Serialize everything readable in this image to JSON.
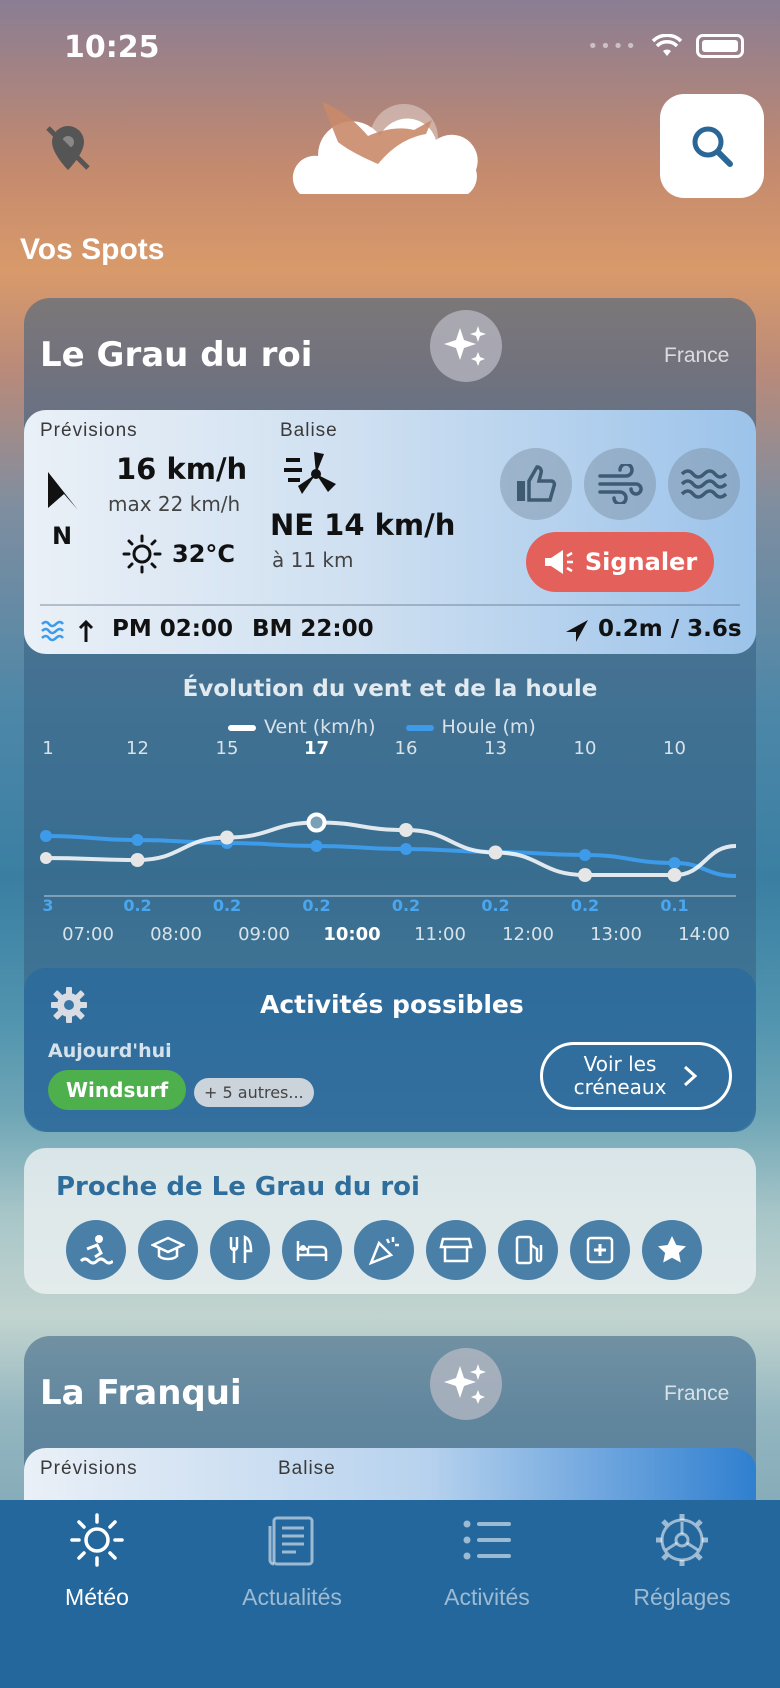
{
  "status": {
    "time": "10:25"
  },
  "header": {
    "section_title": "Vos Spots"
  },
  "spots": [
    {
      "name": "Le Grau du roi",
      "country": "France",
      "forecast_label": "Prévisions",
      "buoy_label": "Balise",
      "wind_dir": "N",
      "wind_speed": "16 km/h",
      "wind_max": "max 22 km/h",
      "temperature": "32°C",
      "buoy_wind": "NE 14 km/h",
      "buoy_distance": "à 11 km",
      "report_label": "Signaler",
      "high_tide": "PM 02:00",
      "low_tide": "BM 22:00",
      "swell": "0.2m / 3.6s"
    },
    {
      "name": "La Franqui",
      "country": "France",
      "forecast_label": "Prévisions",
      "buoy_label": "Balise"
    }
  ],
  "chart_data": {
    "type": "line",
    "title": "Évolution du vent et de la houle",
    "x": [
      "07:00",
      "08:00",
      "09:00",
      "10:00",
      "11:00",
      "12:00",
      "13:00",
      "14:00"
    ],
    "current_x": "10:00",
    "series": [
      {
        "name": "Vent (km/h)",
        "color": "#ffffff",
        "values": [
          12,
          15,
          17,
          16,
          13,
          10,
          10
        ],
        "labels": [
          "1",
          "12",
          "15",
          "17",
          "16",
          "13",
          "10",
          "10"
        ]
      },
      {
        "name": "Houle (m)",
        "color": "#3d9be9",
        "values": [
          0.2,
          0.2,
          0.2,
          0.2,
          0.2,
          0.2,
          0.1
        ],
        "labels": [
          "3",
          "0.2",
          "0.2",
          "0.2",
          "0.2",
          "0.2",
          "0.2",
          "0.1"
        ]
      }
    ]
  },
  "activities": {
    "title": "Activités possibles",
    "today_label": "Aujourd'hui",
    "chip": "Windsurf",
    "more": "+ 5 autres...",
    "slots_line1": "Voir les",
    "slots_line2": "créneaux"
  },
  "nearby": {
    "title": "Proche de Le Grau du roi",
    "icons": [
      "surf-school-icon",
      "graduation-icon",
      "restaurant-icon",
      "hotel-icon",
      "party-icon",
      "shop-icon",
      "fuel-icon",
      "medical-icon",
      "star-icon"
    ]
  },
  "tabs": [
    {
      "label": "Météo",
      "icon": "sun-icon",
      "active": true
    },
    {
      "label": "Actualités",
      "icon": "newspaper-icon",
      "active": false
    },
    {
      "label": "Activités",
      "icon": "list-icon",
      "active": false
    },
    {
      "label": "Réglages",
      "icon": "settings-icon",
      "active": false
    }
  ],
  "colors": {
    "accent": "#24679c",
    "report": "#e4605a",
    "swell": "#3d9be9",
    "chip": "#4db04d"
  }
}
